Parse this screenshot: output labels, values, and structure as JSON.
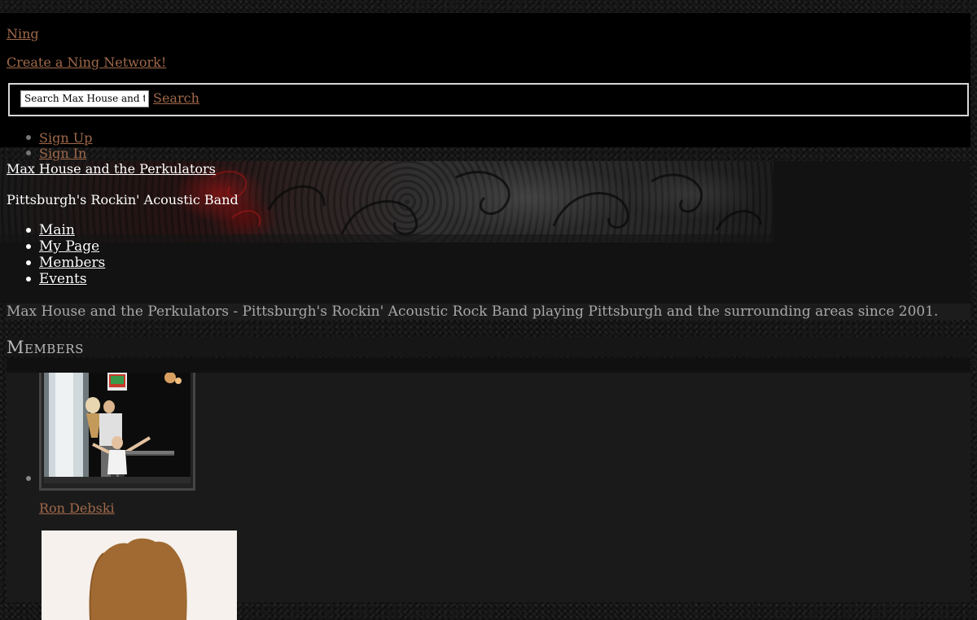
{
  "topbar": {
    "ning_link": "Ning",
    "create_link": "Create a Ning Network!",
    "search": {
      "value": "Search Max House and th",
      "button_label": "Search"
    },
    "account_links": [
      "Sign Up",
      "Sign In"
    ]
  },
  "header": {
    "site_title": "Max House and the Perkulators",
    "tagline": "Pittsburgh's Rockin' Acoustic Band",
    "nav": [
      "Main",
      "My Page",
      "Members",
      "Events"
    ]
  },
  "description": "Max House and the Perkulators - Pittsburgh's Rockin' Acoustic Rock Band playing Pittsburgh and the surrounding areas since 2001.",
  "members": {
    "heading": "Members",
    "items": [
      {
        "name": "Ron Debski",
        "photo_icon": "member-photo-icon"
      },
      {
        "name": "",
        "photo_icon": "default-avatar-icon"
      }
    ]
  },
  "colors": {
    "link": "#a0694a",
    "page_background": "#141414",
    "topbar_background": "#000000",
    "avatar_background": "#f6f1ec",
    "avatar_hair": "#a06a32"
  }
}
